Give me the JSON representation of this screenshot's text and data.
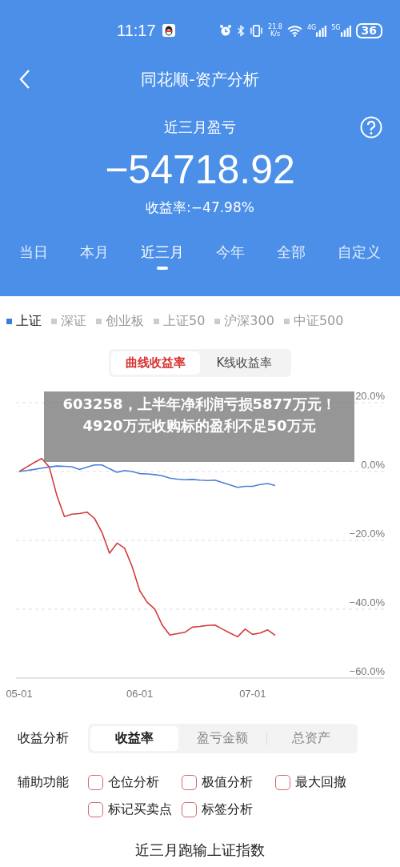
{
  "status_bar": {
    "time": "11:17",
    "net_speed": [
      "21.8",
      "K/s"
    ],
    "networks": [
      "4G",
      "5G"
    ],
    "battery": "36"
  },
  "nav": {
    "title": "同花顺-资产分析"
  },
  "summary": {
    "label": "近三月盈亏",
    "value": "−54718.92",
    "rate": "收益率:−47.98%"
  },
  "periods": [
    {
      "label": "当日",
      "selected": false
    },
    {
      "label": "本月",
      "selected": false
    },
    {
      "label": "近三月",
      "selected": true
    },
    {
      "label": "今年",
      "selected": false
    },
    {
      "label": "全部",
      "selected": false
    },
    {
      "label": "自定义",
      "selected": false
    }
  ],
  "indices": [
    {
      "label": "上证",
      "selected": true
    },
    {
      "label": "深证",
      "selected": false
    },
    {
      "label": "创业板",
      "selected": false
    },
    {
      "label": "上证50",
      "selected": false
    },
    {
      "label": "沪深300",
      "selected": false
    },
    {
      "label": "中证500",
      "selected": false
    }
  ],
  "chart_modes": [
    {
      "label": "曲线收益率",
      "selected": true
    },
    {
      "label": "K线收益率",
      "selected": false
    }
  ],
  "chart": {
    "chart_data": {
      "type": "line",
      "categories": [
        "05-01",
        null,
        null,
        null,
        null,
        null,
        null,
        null,
        null,
        null,
        null,
        null,
        null,
        null,
        null,
        null,
        "06-01",
        null,
        null,
        null,
        null,
        null,
        null,
        null,
        null,
        null,
        null,
        null,
        null,
        null,
        null,
        "07-01",
        null,
        null,
        null
      ],
      "series": [
        {
          "color": "#d63a3a",
          "values": [
            0,
            1.3,
            2.6,
            3.8,
            1.3,
            -7,
            -13.1,
            -12.4,
            -12.2,
            -11.8,
            -13.6,
            -17.7,
            -23.7,
            -20.8,
            -22.3,
            -27.6,
            -34.6,
            -38,
            -39.9,
            -44.6,
            -47.5,
            -47.1,
            -46.7,
            -45.2,
            -45,
            -44.7,
            -44.6,
            -45.8,
            -46.9,
            -48,
            -45.8,
            -47.3,
            -46.9,
            -46,
            -47.6
          ]
        },
        {
          "color": "#4a80d8",
          "values": [
            0,
            0.3,
            0.6,
            1.0,
            1.3,
            1.6,
            1.5,
            1.4,
            0.6,
            1.3,
            1.9,
            1.9,
            0.8,
            -0.2,
            0.3,
            0,
            -0.6,
            -0.7,
            -0.9,
            -1.2,
            -1.9,
            -2.2,
            -2.4,
            -2.3,
            -2.5,
            -2.6,
            -2.5,
            -3.2,
            -3.9,
            -4.6,
            -4.3,
            -4.3,
            -3.8,
            -3.5,
            -4.1
          ]
        }
      ],
      "ylim": [
        -60,
        20
      ],
      "grid": true,
      "yticks": [
        {
          "value": 20,
          "label": "20.0%"
        },
        {
          "value": 0,
          "label": "0.0%"
        },
        {
          "value": -20,
          "label": "−20.0%"
        },
        {
          "value": -40,
          "label": "−40.0%"
        },
        {
          "value": -60,
          "label": "−60.0%"
        }
      ]
    }
  },
  "banner": "603258，上半年净利润亏损5877万元！4920万元收购标的盈利不足50万元",
  "analysis": {
    "label": "收益分析",
    "options": [
      {
        "label": "收益率",
        "selected": true
      },
      {
        "label": "盈亏金额",
        "selected": false
      },
      {
        "label": "总资产",
        "selected": false
      }
    ]
  },
  "aux": {
    "label": "辅助功能",
    "options": [
      {
        "label": "仓位分析",
        "checked": false
      },
      {
        "label": "极值分析",
        "checked": false
      },
      {
        "label": "最大回撤",
        "checked": false
      },
      {
        "label": "标记买卖点",
        "checked": false
      },
      {
        "label": "标签分析",
        "checked": false
      }
    ]
  },
  "footer_heading": "近三月跑输上证指数"
}
